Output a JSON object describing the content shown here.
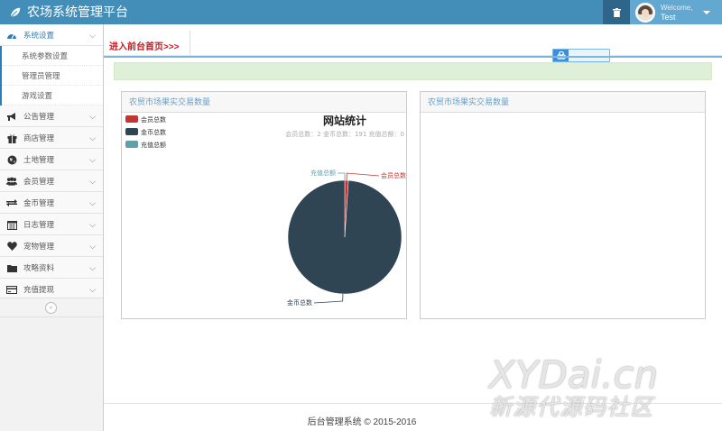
{
  "header": {
    "brand": "农场系统管理平台",
    "user_welcome": "Welcome,",
    "user_name": "Test"
  },
  "sidebar": {
    "items": [
      {
        "label": "系统设置",
        "icon": "dashboard-icon",
        "active": true,
        "expanded": true
      },
      {
        "label": "公告管理",
        "icon": "bullhorn-icon"
      },
      {
        "label": "商店管理",
        "icon": "gift-icon"
      },
      {
        "label": "土地管理",
        "icon": "globe-icon"
      },
      {
        "label": "会员管理",
        "icon": "users-icon"
      },
      {
        "label": "金币管理",
        "icon": "exchange-icon"
      },
      {
        "label": "日志管理",
        "icon": "calendar-icon"
      },
      {
        "label": "宠物管理",
        "icon": "heart-icon"
      },
      {
        "label": "攻略资料",
        "icon": "folder-icon"
      },
      {
        "label": "充值提现",
        "icon": "credit-card-icon"
      }
    ],
    "submenu": [
      "系统参数设置",
      "管理员管理",
      "游戏设置"
    ],
    "collapse_glyph": "«"
  },
  "main": {
    "breadcrumb_link": "进入前台首页>>>",
    "panels": [
      {
        "title": "农贸市场果实交易数量"
      },
      {
        "title": "农贸市场果实交易数量"
      }
    ],
    "footer": "后台管理系统 © 2015-2016"
  },
  "watermark": {
    "main": "XYDai.cn",
    "sub": "新源代源码社区"
  },
  "colors": {
    "navbar": "#438eb9",
    "accent": "#2b7dbc",
    "link_red": "#c9171e",
    "notice_bg": "#dff0d8"
  },
  "chart_data": {
    "type": "pie",
    "title": "网站统计",
    "subtitle": "会员总数：2 金币总数：191 充值总额：0",
    "categories": [
      "会员总数",
      "金币总数",
      "充值总额"
    ],
    "values": [
      2,
      191,
      0
    ],
    "colors": [
      "#c23531",
      "#2f4554",
      "#61a0a8"
    ],
    "legend_position": "top-left"
  }
}
